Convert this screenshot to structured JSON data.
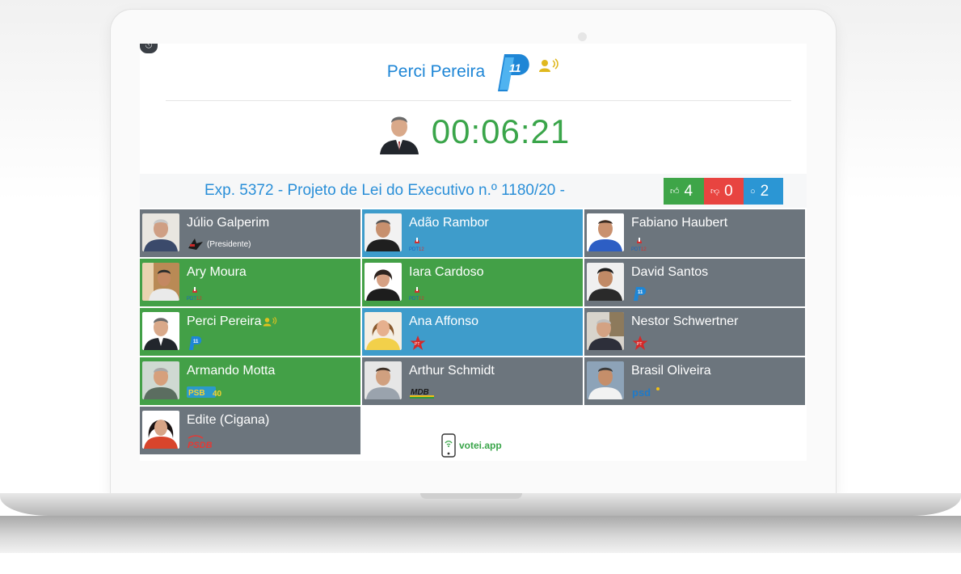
{
  "header": {
    "speaker_name": "Perci Pereira",
    "party_number": "11",
    "timer": "00:06:21"
  },
  "session": {
    "title": "Exp. 5372 - Projeto de Lei do Executivo n.º 1180/20 -",
    "votes_yes": "4",
    "votes_no": "0",
    "votes_abstain": "2"
  },
  "councilors": [
    {
      "name": "Júlio Galperim",
      "party": "PTB",
      "role": "(Presidente)",
      "status": "grey"
    },
    {
      "name": "Adão Rambor",
      "party": "PDT 12",
      "role": "",
      "status": "blue"
    },
    {
      "name": "Fabiano Haubert",
      "party": "PDT 12",
      "role": "",
      "status": "grey"
    },
    {
      "name": "Ary Moura",
      "party": "PDT 12",
      "role": "",
      "status": "green"
    },
    {
      "name": "Iara Cardoso",
      "party": "PDT 12",
      "role": "",
      "status": "green"
    },
    {
      "name": "David Santos",
      "party": "PP 11",
      "role": "",
      "status": "grey"
    },
    {
      "name": "Perci Pereira",
      "party": "PP 11",
      "role": "",
      "status": "green",
      "speaking": true
    },
    {
      "name": "Ana Affonso",
      "party": "PT",
      "role": "",
      "status": "blue"
    },
    {
      "name": "Nestor Schwertner",
      "party": "PT",
      "role": "",
      "status": "grey"
    },
    {
      "name": "Armando Motta",
      "party": "PSB 40",
      "role": "",
      "status": "green"
    },
    {
      "name": "Arthur Schmidt",
      "party": "MDB",
      "role": "",
      "status": "grey"
    },
    {
      "name": "Brasil Oliveira",
      "party": "psd",
      "role": "",
      "status": "grey"
    },
    {
      "name": "Edite (Cigana)",
      "party": "PSDB",
      "role": "",
      "status": "grey"
    }
  ],
  "footer": {
    "app_name": "votei.app"
  },
  "colors": {
    "absent": "#6c757d",
    "yes": "#43a047",
    "present": "#3e9ccb",
    "no": "#e84440"
  }
}
